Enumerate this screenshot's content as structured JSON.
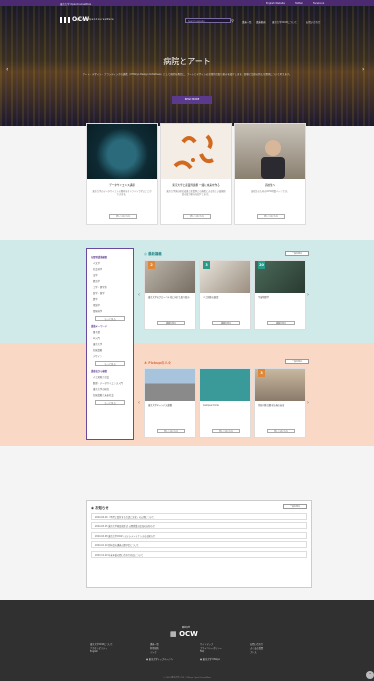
{
  "topbar": {
    "left_text": "東京大学 OpenCourseWare",
    "links": [
      "English Website",
      "Twitter",
      "Facebook"
    ]
  },
  "header": {
    "logo_text": "OCW",
    "logo_subtitle": "東京大学 OpenCourseWare",
    "search_placeholder": "Search website",
    "nav": [
      "講義一覧",
      "講義動画",
      "東京大学OCWについて",
      "お問い合わせ"
    ]
  },
  "hero": {
    "title": "病院とアート",
    "description": "アート・デザイン・ブランディングの連携（UTOkyo Design Initiatives）として病院を舞台に、アートとデザインの実践的な取り組みを紹介します。医療と芸術の新たな関係について考えます。",
    "button": "READ MORE"
  },
  "feature_cards": [
    {
      "title": "データサイエンス講座",
      "desc": "東京大学のデータサイエンス教育をオンラインで学ぶことができます。",
      "button": "詳しくはこちら"
    },
    {
      "title": "東京大学と産業界連携 一緒に未来を作る",
      "desc": "東京大学発の研究成果と産業界との連携による新しい価値創造の取り組みを紹介します。",
      "button": "詳しくはこちら"
    },
    {
      "title": "高校生へ",
      "desc": "高校生のためのOCW特集ページです。",
      "button": "詳しくはこちら"
    }
  ],
  "sidebar": {
    "section1_title": "分野別講義検索",
    "section1_items": [
      "人文学",
      "社会科学",
      "法学",
      "経済学",
      "工学・理学系",
      "医学・薬学",
      "農学",
      "環境学",
      "情報科学"
    ],
    "more1": "もっと見る",
    "section2_title": "講義キーワード",
    "section2_items": [
      "量子論",
      "AI入門",
      "東京大学",
      "気候変動",
      "デザイン"
    ],
    "more2": "もっと見る",
    "section3_title": "講義名から検索",
    "section3_items": [
      "人工知能と社会",
      "数理・データサイエンス入門",
      "東京大学の研究",
      "気候変動と未来社会"
    ],
    "more3": "もっと見る"
  },
  "new_section": {
    "title": "最新講義",
    "view_all": "一覧を見る",
    "cards": [
      {
        "badge": "2",
        "badge_color": "#e0883a",
        "title": "東京大学のグローバル化に向けた取り組み",
        "button": "講義を見る"
      },
      {
        "badge": "3",
        "badge_color": "#2a9a8a",
        "title": "人工知能の展望",
        "button": "講義を見る"
      },
      {
        "badge": "20",
        "badge_color": "#2a9a8a",
        "title": "宇宙物理学",
        "button": "講義を見る"
      }
    ]
  },
  "popular_section": {
    "title": "Pickupの人々",
    "view_all": "一覧を見る",
    "cards": [
      {
        "badge": "",
        "badge_color": "#e0883a",
        "title": "東京大学キャンパス建築",
        "button": "詳しくはこちら"
      },
      {
        "badge": "",
        "badge_color": "#2a9a8a",
        "title": "Campus Circle",
        "button": "詳しくはこちら"
      },
      {
        "badge": "3",
        "badge_color": "#e0883a",
        "title": "持続可能な都市計画の未来",
        "button": "詳しくはこちら"
      }
    ]
  },
  "news": {
    "title": "お知らせ",
    "view_all": "一覧を見る",
    "items": [
      "2024.04.26 「時代と変化する言語と文化」の公開について",
      "2024.03.15 東京大学総長就任式 公開授業の追加のお知らせ",
      "2024.02.28 東京大学OCWシステムメンテナンスのお知らせ",
      "2024.01.10 新年度の講義公開予定について",
      "2023.12.20 年末年始の問い合わせ対応について"
    ]
  },
  "footer": {
    "logo_text": "OCW",
    "logo_subtitle": "東京大学",
    "links": [
      "東京大学OCWについて",
      "講義一覧",
      "サイトマップ",
      "お問い合わせ",
      "アクセシビリティ",
      "利用規約",
      "プライバシーポリシー",
      "English",
      "リンク",
      "FAQ",
      "よくある質問",
      "プレス"
    ],
    "btn1": "東京大学トップページへ",
    "btn2": "東京大学 UTokyo",
    "copyright": "© 2024 東京大学OCW / UTokyo OpenCourseWare"
  },
  "colors": {
    "purple": "#5b3a8e",
    "teal_band": "#cfeae9",
    "peach_band": "#f9d9c6",
    "footer": "#303030"
  }
}
